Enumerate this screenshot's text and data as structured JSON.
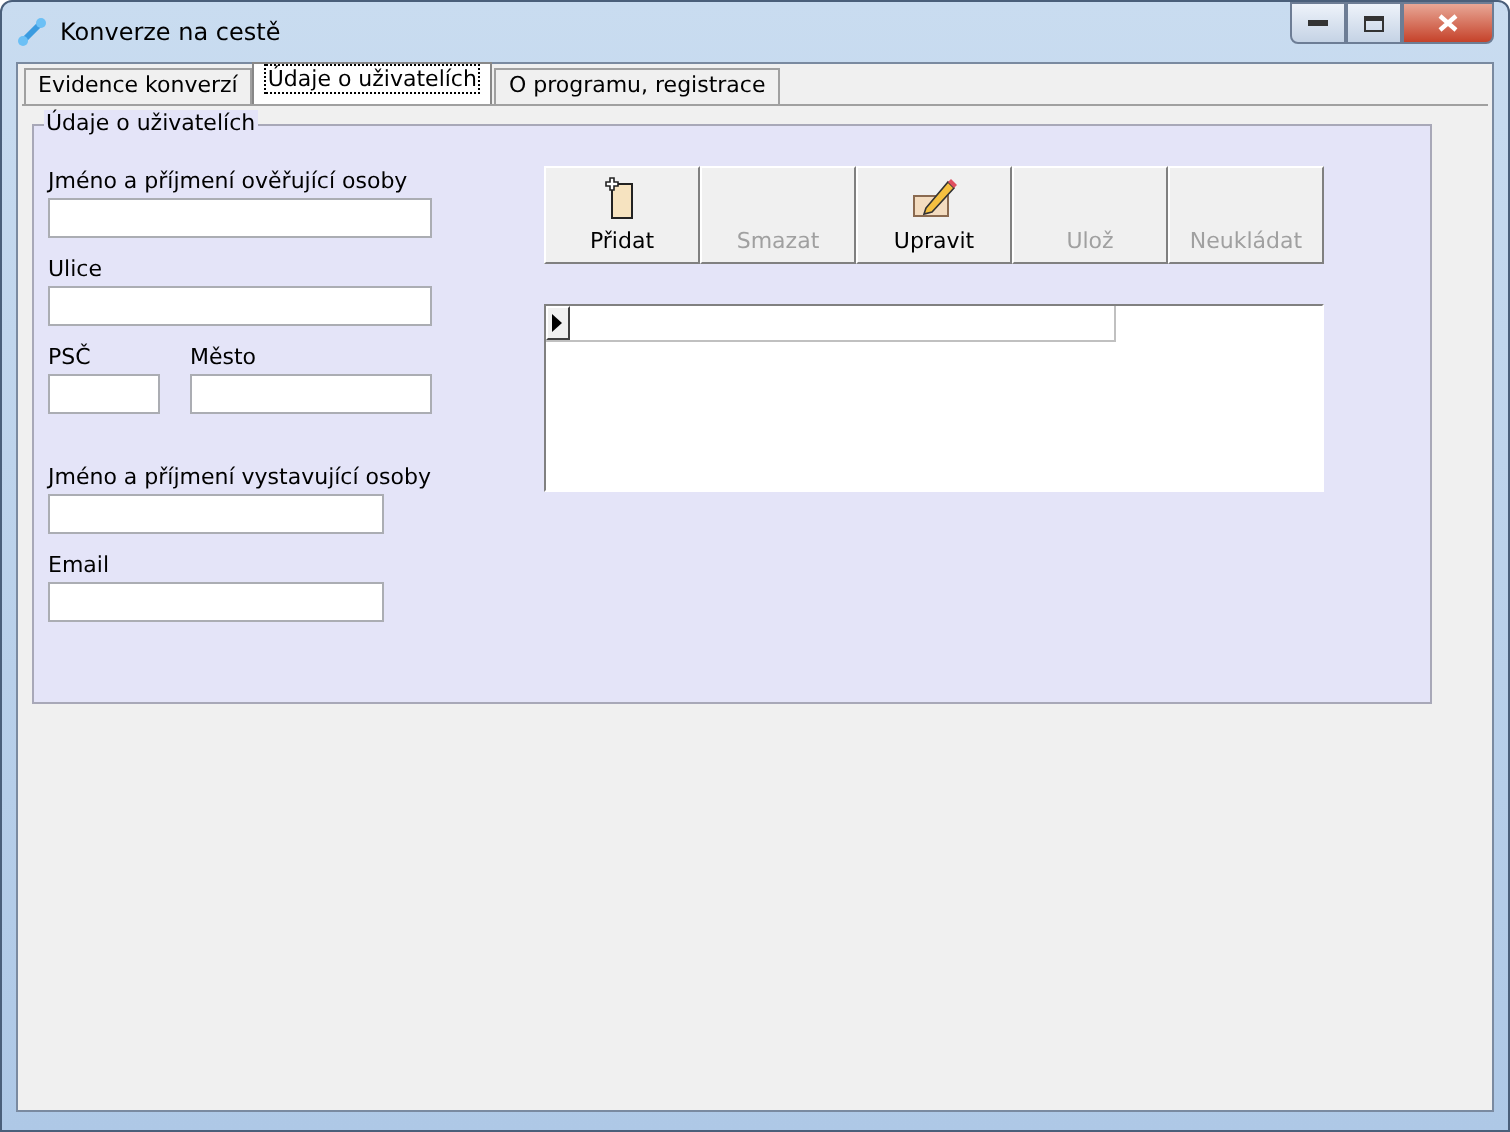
{
  "window": {
    "title": "Konverze na cestě"
  },
  "tabs": [
    {
      "label": "Evidence konverzí",
      "selected": false
    },
    {
      "label": "Údaje o uživatelích",
      "selected": true
    },
    {
      "label": "O programu, registrace",
      "selected": false
    }
  ],
  "group": {
    "title": "Údaje o uživatelích"
  },
  "field_rows": [
    [
      {
        "label": "Jméno a příjmení ověřující osoby"
      }
    ],
    [
      {
        "label": "Ulice"
      }
    ],
    [
      {
        "label": "PSČ"
      },
      {
        "label": "Město"
      }
    ],
    [
      {
        "label": "Jméno a příjmení vystavující osoby"
      }
    ],
    [
      {
        "label": "Email"
      }
    ]
  ],
  "buttons": [
    {
      "label": "Přidat",
      "kind": "add",
      "disabled": false
    },
    {
      "label": "Smazat",
      "kind": "plain",
      "disabled": true
    },
    {
      "label": "Upravit",
      "kind": "edit",
      "disabled": false
    },
    {
      "label": "Ulož",
      "kind": "plain",
      "disabled": true
    },
    {
      "label": "Neukládat",
      "kind": "plain",
      "disabled": true
    }
  ]
}
